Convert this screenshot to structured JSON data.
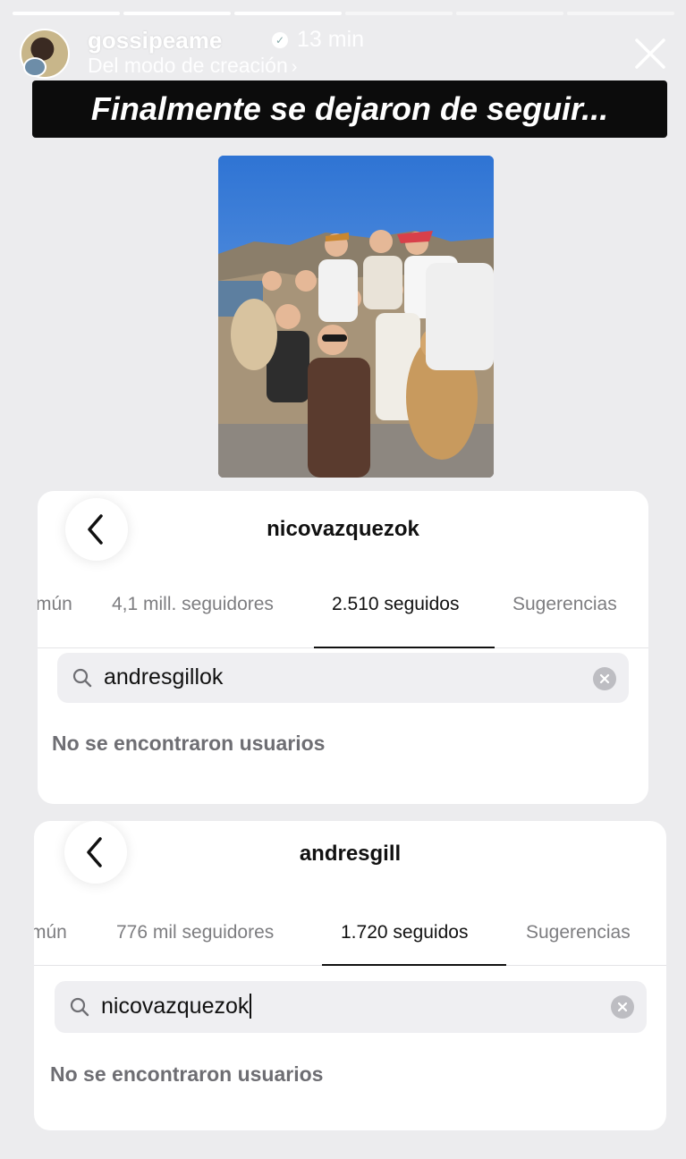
{
  "story": {
    "progress_segments": [
      1,
      1,
      1,
      0,
      0,
      0
    ],
    "username": "gossipeame",
    "time": "13 min",
    "subline": "Del modo de creación",
    "caption": "Finalmente se dejaron de seguir..."
  },
  "card1": {
    "title": "nicovazquezok",
    "tabs": [
      {
        "label": "mún",
        "active": false
      },
      {
        "label": "4,1 mill. seguidores",
        "active": false
      },
      {
        "label": "2.510 seguidos",
        "active": true
      },
      {
        "label": "Sugerencias",
        "active": false
      }
    ],
    "search_value": "andresgillok",
    "empty_text": "No se encontraron usuarios"
  },
  "card2": {
    "title": "andresgill",
    "tabs": [
      {
        "label": "mún",
        "active": false
      },
      {
        "label": "776 mil seguidores",
        "active": false
      },
      {
        "label": "1.720 seguidos",
        "active": true
      },
      {
        "label": "Sugerencias",
        "active": false
      }
    ],
    "search_value": "nicovazquezok",
    "empty_text": "No se encontraron usuarios"
  },
  "colors": {
    "background": "#ececee",
    "banner": "#0c0c0c",
    "active_tab": "#111111",
    "inactive_tab": "#7d7d80"
  },
  "icons": {
    "back": "chevron-left-icon",
    "search": "search-icon",
    "clear": "clear-icon",
    "close": "close-icon",
    "verified": "verified-badge-icon"
  }
}
